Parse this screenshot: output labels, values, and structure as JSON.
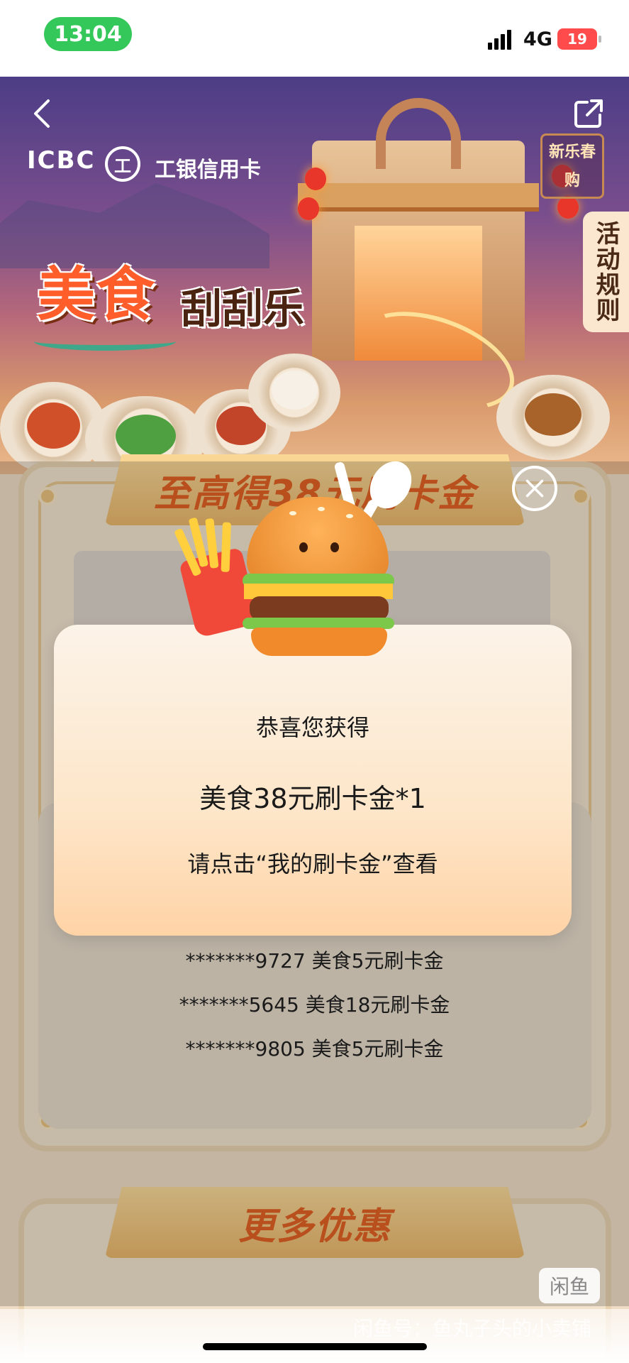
{
  "status_bar": {
    "time": "13:04",
    "network": "4G",
    "battery": "19"
  },
  "hero": {
    "brand_en": "ICBC",
    "brand_emblem": "工",
    "brand_cn": "工银信用卡",
    "seal_text": "新乐春购",
    "title_main": "美食",
    "title_sub": "刮刮乐",
    "rules_tab": "活动规则"
  },
  "card1": {
    "ribbon": "至高得38元刷卡金"
  },
  "popup": {
    "line1": "恭喜您获得",
    "line2": "美食38元刷卡金*1",
    "line3": "请点击“我的刷卡金”查看"
  },
  "winners": [
    "*******9727 美食5元刷卡金",
    "*******5645 美食18元刷卡金",
    "*******9805 美食5元刷卡金"
  ],
  "card2": {
    "ribbon": "更多优惠"
  },
  "watermark": {
    "badge": "闲鱼",
    "text": "闲鱼号：鱼丸子头的小卖铺"
  },
  "icons": [
    "back-icon",
    "share-icon",
    "close-icon",
    "signal-icon",
    "battery-icon"
  ],
  "colors": {
    "accent": "#e05a1a",
    "time_pill": "#34c759",
    "battery": "#ff4b4b"
  }
}
